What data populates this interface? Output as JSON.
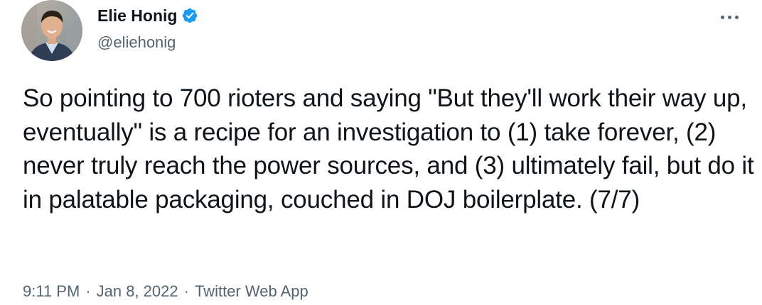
{
  "author": {
    "display_name": "Elie Honig",
    "handle": "@eliehonig",
    "verified": true,
    "verified_icon": "verified-badge-icon",
    "avatar_icon": "profile-avatar"
  },
  "menu": {
    "icon": "more-horizontal-icon"
  },
  "tweet": {
    "text": "So pointing to 700 rioters and saying \"But they'll work their way up, eventually\" is a recipe for an investigation to (1) take forever, (2) never truly reach the power sources, and (3) ultimately fail, but do it in palatable packaging, couched in DOJ boilerplate. (7/7)"
  },
  "meta": {
    "time": "9:11 PM",
    "separator": "·",
    "date": "Jan 8, 2022",
    "source": "Twitter Web App"
  },
  "colors": {
    "text_primary": "#0f1419",
    "text_secondary": "#536471",
    "verified_blue": "#1d9bf0",
    "background": "#ffffff"
  }
}
